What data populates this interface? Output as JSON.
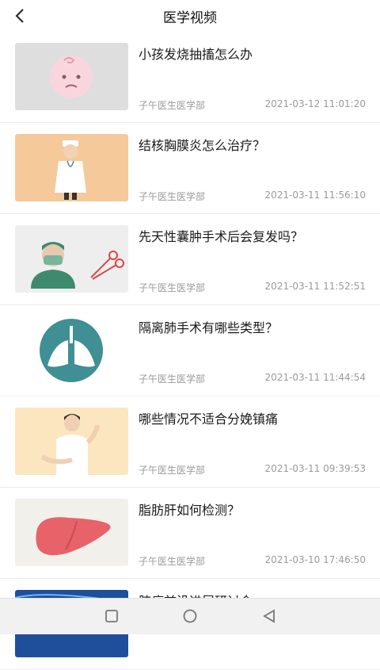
{
  "header": {
    "title": "医学视频"
  },
  "items": [
    {
      "title": "小孩发烧抽搐怎么办",
      "source": "子午医生医学部",
      "date": "2021-03-12 11:01:20"
    },
    {
      "title": "结核胸膜炎怎么治疗？",
      "source": "子午医生医学部",
      "date": "2021-03-11 11:56:10"
    },
    {
      "title": "先天性囊肿手术后会复发吗？",
      "source": "子午医生医学部",
      "date": "2021-03-11 11:52:51"
    },
    {
      "title": "隔离肺手术有哪些类型？",
      "source": "子午医生医学部",
      "date": "2021-03-11 11:44:54"
    },
    {
      "title": "哪些情况不适合分娩镇痛",
      "source": "子午医生医学部",
      "date": "2021-03-11 09:39:53"
    },
    {
      "title": "脂肪肝如何检测？",
      "source": "子午医生医学部",
      "date": "2021-03-10 17:46:50"
    },
    {
      "title": "肺癌前沿进展研讨会",
      "source": "",
      "date": ""
    }
  ],
  "icons": {
    "back": "chevron-left-icon",
    "nav_recent": "square-icon",
    "nav_home": "circle-icon",
    "nav_back": "triangle-back-icon"
  }
}
